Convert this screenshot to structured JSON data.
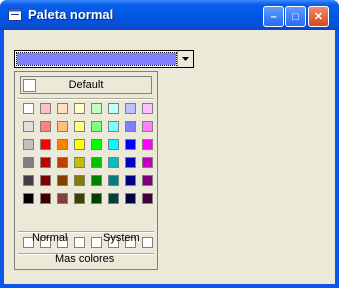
{
  "window": {
    "title": "Paleta normal",
    "minimize_glyph": "–",
    "maximize_glyph": "□",
    "close_glyph": "✕"
  },
  "combo": {
    "selected_color": "#8080ff",
    "arrow_icon": "chevron-down-icon"
  },
  "dropdown": {
    "default_label": "Default",
    "palette": [
      [
        "#ffffff",
        "#ffc0c0",
        "#ffe0c0",
        "#ffffc0",
        "#c0ffc0",
        "#c0ffff",
        "#c0c0ff",
        "#ffc0ff"
      ],
      [
        "#e0e0e0",
        "#ff8080",
        "#ffc080",
        "#ffff80",
        "#80ff80",
        "#80ffff",
        "#8080ff",
        "#ff80ff"
      ],
      [
        "#c0c0c0",
        "#ff0000",
        "#ff8000",
        "#ffff00",
        "#00ff00",
        "#00ffff",
        "#0000ff",
        "#ff00ff"
      ],
      [
        "#808080",
        "#c00000",
        "#c04000",
        "#c0c000",
        "#00c000",
        "#00c0c0",
        "#0000c0",
        "#c000c0"
      ],
      [
        "#404040",
        "#800000",
        "#804000",
        "#808000",
        "#008000",
        "#008080",
        "#000080",
        "#800080"
      ],
      [
        "#000000",
        "#400000",
        "#804040",
        "#404000",
        "#004000",
        "#004040",
        "#000040",
        "#400040"
      ]
    ],
    "custom_colors": [
      "#ffffff",
      "#ffffff",
      "#ffffff",
      "#ffffff",
      "#ffffff",
      "#ffffff",
      "#ffffff",
      "#ffffff"
    ],
    "normal_label": "Normal",
    "system_label": "System",
    "more_colors_label": "Mas colores"
  }
}
